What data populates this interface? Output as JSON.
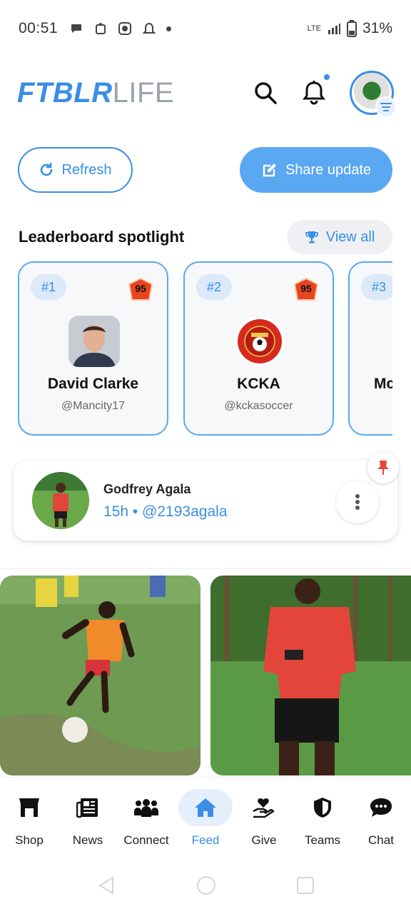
{
  "status_bar": {
    "time": "00:51",
    "network": "LTE",
    "battery": "31%"
  },
  "header": {
    "logo_bold": "FTBLR",
    "logo_light": "LIFE"
  },
  "actions": {
    "refresh_label": "Refresh",
    "share_label": "Share update"
  },
  "leaderboard": {
    "title": "Leaderboard spotlight",
    "view_all_label": "View all",
    "cards": [
      {
        "rank": "#1",
        "score": "95",
        "name": "David Clarke",
        "handle": "@Mancity17"
      },
      {
        "rank": "#2",
        "score": "95",
        "name": "KCKA",
        "handle": "@kckasoccer"
      },
      {
        "rank": "#3",
        "score": "",
        "name": "Mc",
        "handle": ""
      }
    ]
  },
  "post": {
    "author": "Godfrey Agala",
    "meta": "15h • @2193agala"
  },
  "nav": {
    "items": [
      {
        "label": "Shop",
        "icon": "shop-icon"
      },
      {
        "label": "News",
        "icon": "news-icon"
      },
      {
        "label": "Connect",
        "icon": "connect-icon"
      },
      {
        "label": "Feed",
        "icon": "home-icon",
        "active": true
      },
      {
        "label": "Give",
        "icon": "give-icon"
      },
      {
        "label": "Teams",
        "icon": "shield-icon"
      },
      {
        "label": "Chat",
        "icon": "chat-icon"
      }
    ]
  },
  "colors": {
    "accent": "#3a8ee6",
    "accent_light": "#5aa7f2",
    "score_badge": "#e8451e"
  }
}
